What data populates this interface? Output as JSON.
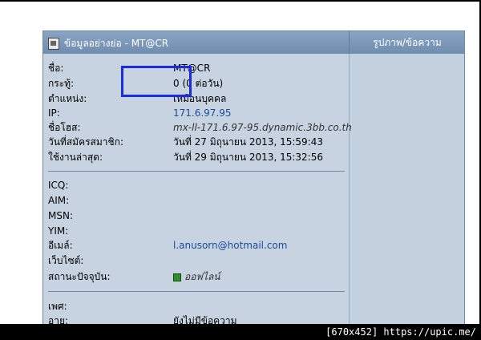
{
  "panel": {
    "title": "ข้อมูลอย่างย่อ - MT@CR",
    "right_header": "รูปภาพ/ข้อความ"
  },
  "profile": [
    {
      "label": "ชื่อ:",
      "value": "MT@CR"
    },
    {
      "label": "กระทู้:",
      "value": "0 (0 ต่อวัน)"
    },
    {
      "label": "ตำแหน่ง:",
      "value": "เหมือนบุคคล"
    },
    {
      "label": "IP:",
      "value": "171.6.97.95"
    },
    {
      "label": "ชื่อโฮส:",
      "value": "mx-ll-171.6.97-95.dynamic.3bb.co.th"
    },
    {
      "label": "วันที่สมัครสมาชิก:",
      "value": "วันที่ 27 มิถุนายน 2013, 15:59:43"
    },
    {
      "label": "ใช้งานล่าสุด:",
      "value": "วันที่ 29 มิถุนายน 2013, 15:32:56"
    }
  ],
  "contacts": [
    {
      "label": "ICQ:",
      "value": ""
    },
    {
      "label": "AIM:",
      "value": ""
    },
    {
      "label": "MSN:",
      "value": ""
    },
    {
      "label": "YIM:",
      "value": ""
    },
    {
      "label": "อีเมล์:",
      "value": "l.anusorn@hotmail.com"
    },
    {
      "label": "เว็บไซต์:",
      "value": ""
    },
    {
      "label": "สถานะปัจจุบัน:",
      "value": "ออฟไลน์"
    }
  ],
  "extra": [
    {
      "label": "เพศ:",
      "value": ""
    },
    {
      "label": "อายุ:",
      "value": "ยังไม่มีข้อความ"
    }
  ],
  "caption": "[670x452] https://upic.me/",
  "colors": {
    "header": "#6f8db0",
    "panel": "#c7d3e1",
    "highlight": "#1b2be0",
    "link": "#1a4d9c"
  }
}
